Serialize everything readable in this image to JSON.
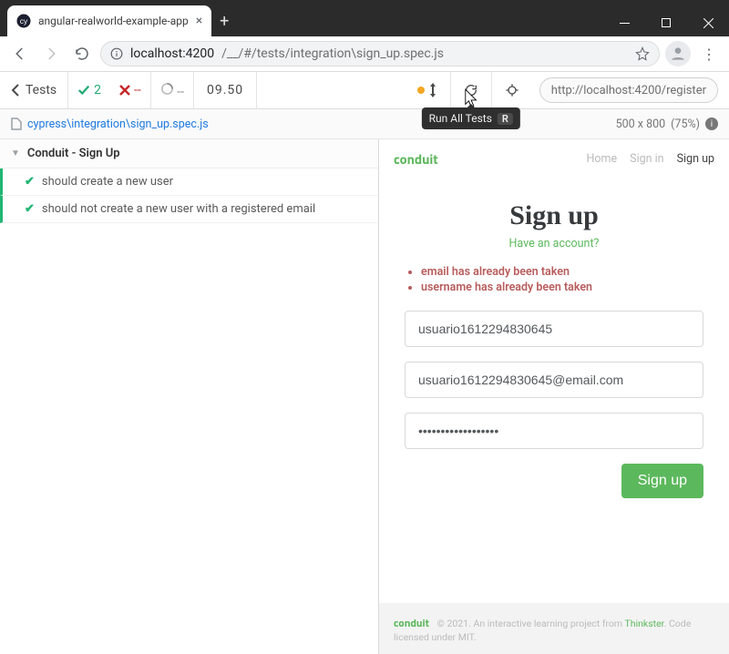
{
  "browser": {
    "tab_title": "angular-realworld-example-app",
    "url_host": "localhost:4200",
    "url_path": "/__/#/tests/integration\\sign_up.spec.js"
  },
  "cypress": {
    "tests_label": "Tests",
    "passed": "2",
    "failed": "--",
    "time": "09.50",
    "url": "http://localhost:4200/register",
    "tooltip": "Run All Tests",
    "tooltip_key": "R",
    "spec_path": "cypress\\integration\\sign_up.spec.js",
    "viewport": "500 x 800",
    "scale": "(75%)"
  },
  "reporter": {
    "suite": "Conduit - Sign Up",
    "tests": [
      "should create a new user",
      "should not create a new user with a registered email"
    ]
  },
  "app": {
    "brand": "conduit",
    "nav": {
      "home": "Home",
      "signin": "Sign in",
      "signup": "Sign up"
    },
    "heading": "Sign up",
    "have_account": "Have an account?",
    "errors": [
      "email has already been taken",
      "username has already been taken"
    ],
    "username": "usuario1612294830645",
    "email": "usuario1612294830645@email.com",
    "password": "••••••••••••••••••",
    "submit": "Sign up",
    "footer_year": "© 2021.",
    "footer_text1": "An interactive learning project from ",
    "footer_link": "Thinkster",
    "footer_text2": ". Code licensed under MIT."
  }
}
